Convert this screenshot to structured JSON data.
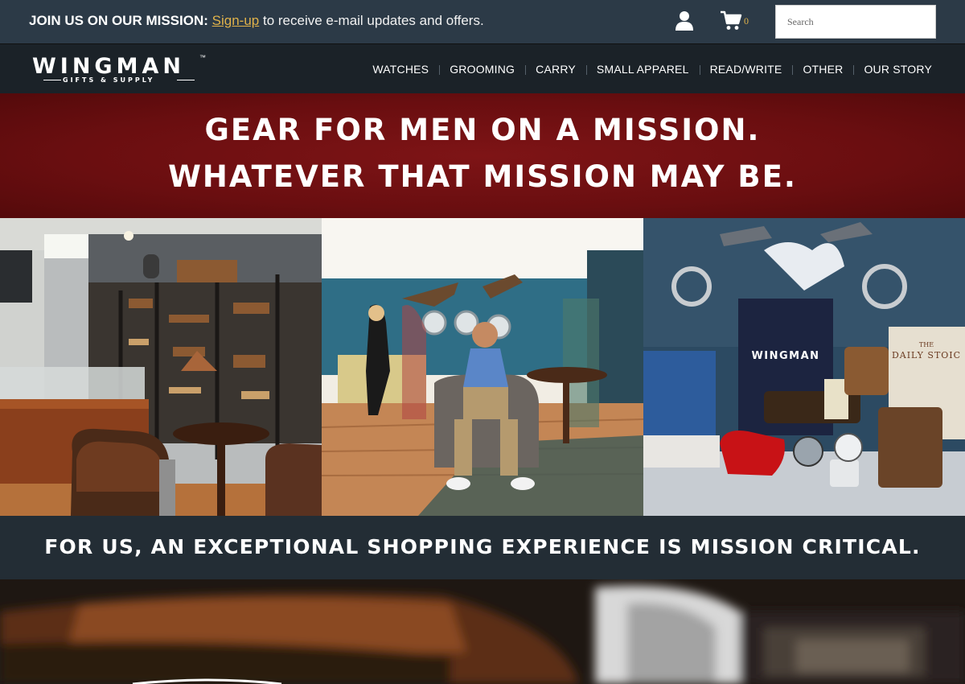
{
  "topbar": {
    "promo_lead": "JOIN US ON OUR MISSION:",
    "promo_link": "Sign-up",
    "promo_rest": "to receive e-mail updates and offers.",
    "cart_count": "0",
    "search_placeholder": "Search",
    "icons": [
      "user-icon",
      "cart-icon"
    ]
  },
  "brand": {
    "name": "WINGMAN",
    "tm": "™",
    "tagline": "GIFTS & SUPPLY"
  },
  "nav": {
    "items": [
      {
        "label": "WATCHES"
      },
      {
        "label": "GROOMING"
      },
      {
        "label": "CARRY"
      },
      {
        "label": "SMALL APPAREL"
      },
      {
        "label": "READ/WRITE"
      },
      {
        "label": "OTHER"
      },
      {
        "label": "OUR STORY"
      }
    ]
  },
  "hero": {
    "line1": "GEAR FOR MEN ON A MISSION.",
    "line2": "WHATEVER THAT MISSION MAY BE."
  },
  "photos": {
    "bag_brand": "WINGMAN",
    "book_title": "DAILY STOIC",
    "book_the": "THE"
  },
  "tagline": {
    "text": "FOR US, AN EXCEPTIONAL SHOPPING EXPERIENCE IS MISSION CRITICAL."
  },
  "colors": {
    "topbar": "#2c3a47",
    "navbar": "#1b2228",
    "hero_red": "#6a0e10",
    "link_gold": "#e0b24a",
    "tagline_bg": "#232d35"
  }
}
